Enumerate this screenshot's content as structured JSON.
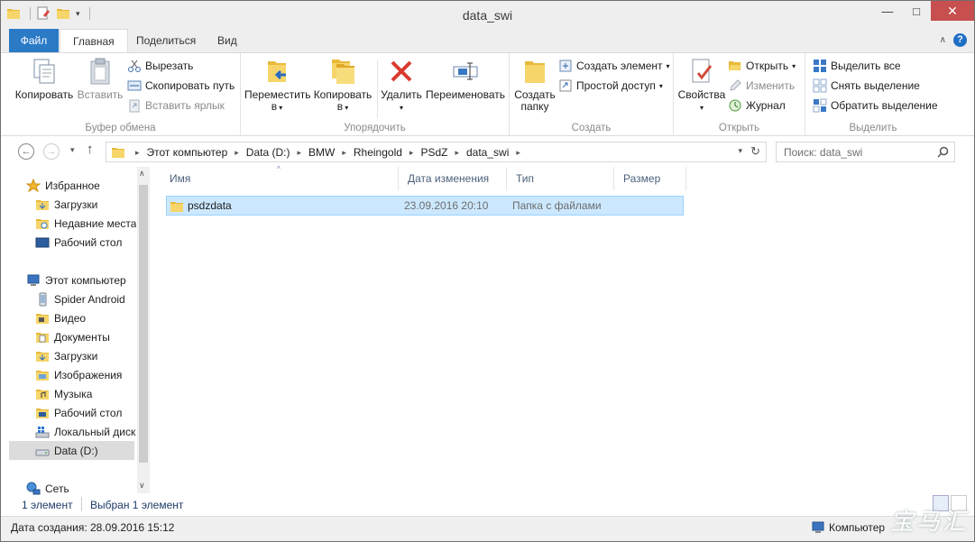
{
  "window": {
    "title": "data_swi"
  },
  "titlebar": {
    "minimize": "—",
    "maximize": "□",
    "close": "✕"
  },
  "tabs": {
    "file": "Файл",
    "home": "Главная",
    "share": "Поделиться",
    "view": "Вид"
  },
  "ribbon": {
    "clipboard": {
      "label": "Буфер обмена",
      "copy": "Копировать",
      "paste": "Вставить",
      "cut": "Вырезать",
      "copy_path": "Скопировать путь",
      "paste_shortcut": "Вставить ярлык"
    },
    "organize": {
      "label": "Упорядочить",
      "move_to_1": "Переместить",
      "move_to_2": "в",
      "copy_to_1": "Копировать",
      "copy_to_2": "в",
      "delete": "Удалить",
      "rename": "Переименовать"
    },
    "create": {
      "label": "Создать",
      "new_folder_1": "Создать",
      "new_folder_2": "папку",
      "new_item": "Создать элемент",
      "easy_access": "Простой доступ"
    },
    "open": {
      "label": "Открыть",
      "properties": "Свойства",
      "open": "Открыть",
      "edit": "Изменить",
      "history": "Журнал"
    },
    "select": {
      "label": "Выделить",
      "select_all": "Выделить все",
      "select_none": "Снять выделение",
      "invert": "Обратить выделение"
    }
  },
  "address": {
    "crumbs": [
      "Этот компьютер",
      "Data (D:)",
      "BMW",
      "Rheingold",
      "PSdZ",
      "data_swi"
    ],
    "search_placeholder": "Поиск: data_swi"
  },
  "nav": {
    "favorites": "Избранное",
    "downloads": "Загрузки",
    "recent": "Недавние места",
    "desktop": "Рабочий стол",
    "this_pc": "Этот компьютер",
    "spider": "Spider Android",
    "video": "Видео",
    "documents": "Документы",
    "downloads2": "Загрузки",
    "images": "Изображения",
    "music": "Музыка",
    "desktop2": "Рабочий стол",
    "local_disk": "Локальный диск",
    "data_d": "Data (D:)",
    "network": "Сеть"
  },
  "columns": {
    "name": "Имя",
    "date": "Дата изменения",
    "type": "Тип",
    "size": "Размер"
  },
  "files": [
    {
      "name": "psdzdata",
      "date": "23.09.2016 20:10",
      "type": "Папка с файлами",
      "size": ""
    }
  ],
  "status": {
    "count": "1 элемент",
    "selected": "Выбран 1 элемент"
  },
  "infobar": {
    "created": "Дата создания: 28.09.2016 15:12",
    "computer": "Компьютер"
  },
  "watermark": "宝马汇",
  "colors": {
    "accent": "#2a7ac6",
    "selection": "#cce8ff",
    "close": "#c74f4f"
  }
}
